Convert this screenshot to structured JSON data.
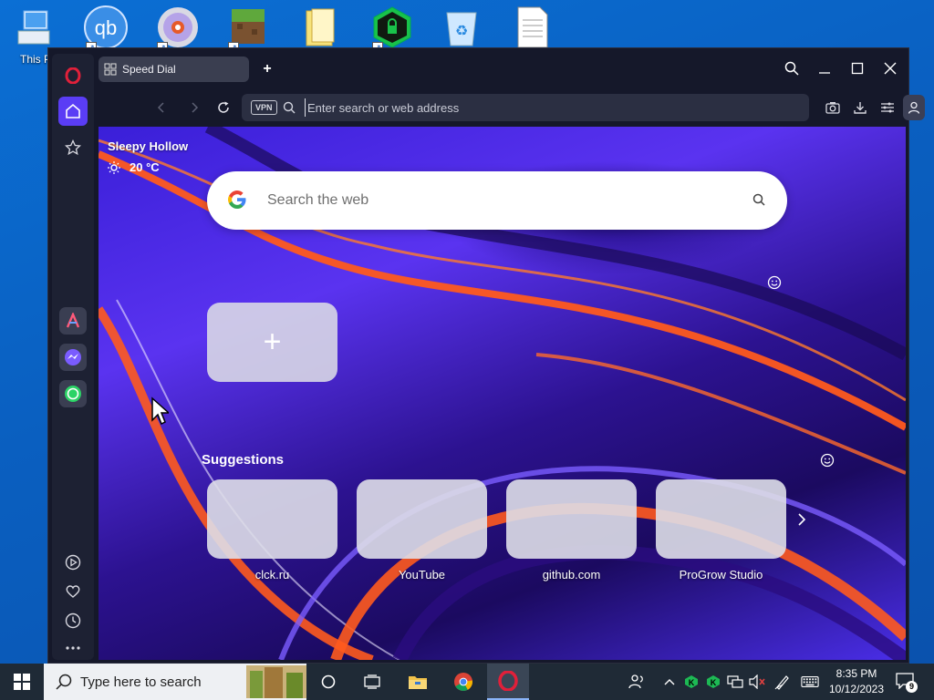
{
  "desktop": {
    "icons": [
      {
        "name": "this-pc",
        "label": "This P"
      },
      {
        "name": "qbittorrent",
        "label": "qb"
      },
      {
        "name": "dvd",
        "label": ""
      },
      {
        "name": "minecraft",
        "label": ""
      },
      {
        "name": "folder-docs",
        "label": ""
      },
      {
        "name": "vpn-app",
        "label": ""
      },
      {
        "name": "recycle-bin",
        "label": ""
      },
      {
        "name": "text-doc",
        "label": ""
      }
    ]
  },
  "browser": {
    "tab": {
      "label": "Speed Dial"
    },
    "address": {
      "placeholder": "Enter search or web address",
      "vpn_badge": "VPN"
    },
    "accent": "#5a3df5",
    "brand": "#e0203a"
  },
  "speed_dial": {
    "weather": {
      "city": "Sleepy Hollow",
      "temp": "20 °C"
    },
    "search": {
      "placeholder": "Search the web"
    },
    "suggestions_title": "Suggestions",
    "add_tile": "+",
    "tiles": [
      {
        "label": "clck.ru"
      },
      {
        "label": "YouTube"
      },
      {
        "label": "github.com"
      },
      {
        "label": "ProGrow Studio"
      }
    ]
  },
  "taskbar": {
    "search_placeholder": "Type here to search",
    "time": "8:35 PM",
    "date": "10/12/2023",
    "notifications": "9"
  }
}
